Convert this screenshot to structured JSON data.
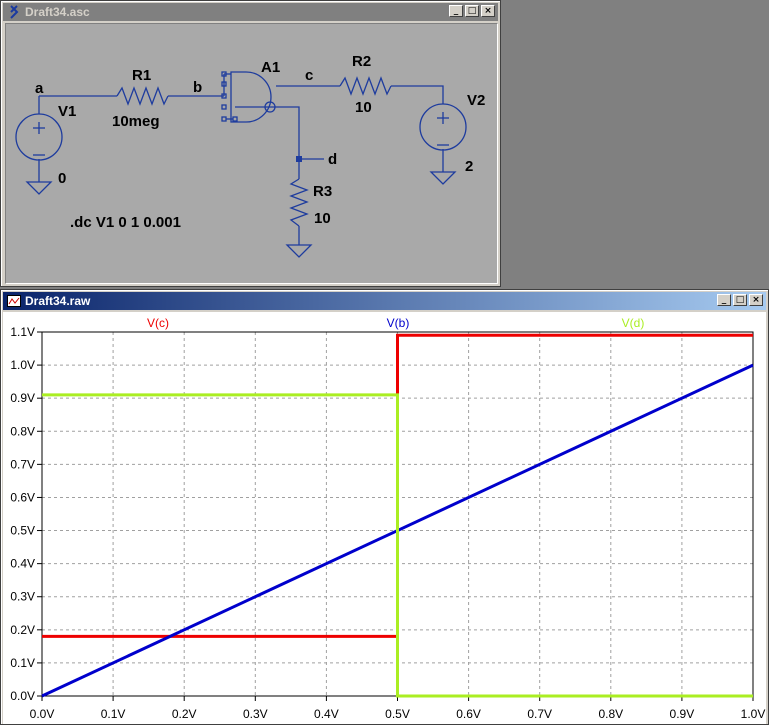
{
  "schematic_window": {
    "title": "Draft34.asc",
    "buttons": [
      "_",
      "□",
      "×"
    ],
    "labels": {
      "node_a": "a",
      "node_b": "b",
      "node_c": "c",
      "node_d": "d",
      "v1": "V1",
      "v1_value": "0",
      "r1": "R1",
      "r1_value": "10meg",
      "a1": "A1",
      "r2": "R2",
      "r2_value": "10",
      "v2": "V2",
      "v2_value": "2",
      "r3": "R3",
      "r3_value": "10",
      "directive": ".dc V1 0 1 0.001"
    }
  },
  "plot_window": {
    "title": "Draft34.raw",
    "buttons": [
      "_",
      "□",
      "×"
    ]
  },
  "chart_data": {
    "type": "line",
    "xlim": [
      0,
      1
    ],
    "ylim": [
      0,
      1.1
    ],
    "x_ticks": [
      "0.0V",
      "0.1V",
      "0.2V",
      "0.3V",
      "0.4V",
      "0.5V",
      "0.6V",
      "0.7V",
      "0.8V",
      "0.9V",
      "1.0V"
    ],
    "y_ticks": [
      "0.0V",
      "0.1V",
      "0.2V",
      "0.3V",
      "0.4V",
      "0.5V",
      "0.6V",
      "0.7V",
      "0.8V",
      "0.9V",
      "1.0V",
      "1.1V"
    ],
    "grid": true,
    "series": [
      {
        "name": "V(c)",
        "color": "#ee0000",
        "x": [
          0,
          0.5,
          0.5,
          1.0
        ],
        "y": [
          0.18,
          0.18,
          1.09,
          1.09
        ]
      },
      {
        "name": "V(b)",
        "color": "#0000cc",
        "x": [
          0,
          1.0
        ],
        "y": [
          0,
          1.0
        ]
      },
      {
        "name": "V(d)",
        "color": "#aaee22",
        "x": [
          0,
          0.5,
          0.5,
          1.0
        ],
        "y": [
          0.91,
          0.91,
          0.0,
          0.0
        ]
      }
    ]
  }
}
